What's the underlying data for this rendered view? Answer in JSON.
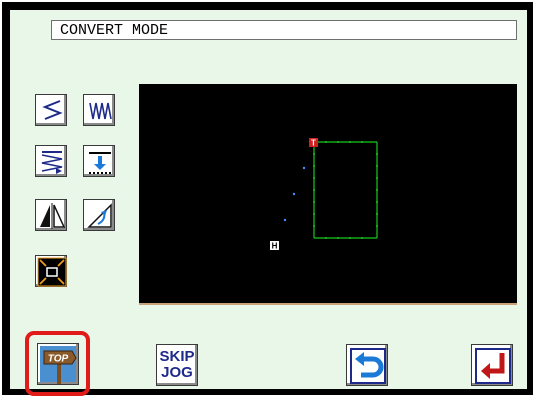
{
  "title": "CONVERT MODE",
  "tools": [
    {
      "name": "zigzag-stitch-tool",
      "icon": "zigzag-stitch-icon"
    },
    {
      "name": "wave-stitch-tool",
      "icon": "wave-stitch-icon"
    },
    {
      "name": "multi-line-stitch-tool",
      "icon": "multi-line-stitch-icon"
    },
    {
      "name": "offset-down-tool",
      "icon": "offset-down-arrow-icon"
    },
    {
      "name": "mirror-tool",
      "icon": "mirror-icon"
    },
    {
      "name": "rotate-tool",
      "icon": "rotate-icon"
    },
    {
      "name": "scale-tool",
      "icon": "scale-icon"
    }
  ],
  "canvas": {
    "start_marker": "T",
    "home_marker": "H",
    "pattern_color": "#19c819",
    "marker_color": "#d22020"
  },
  "buttons": {
    "top_label": "TOP",
    "skip_jog_line1": "SKIP",
    "skip_jog_line2": "JOG"
  },
  "colors": {
    "panel_bg": "#e9f7e9",
    "canvas_bg": "#000000",
    "highlight": "#e11a1a",
    "icon_blue": "#1d2a8a"
  }
}
